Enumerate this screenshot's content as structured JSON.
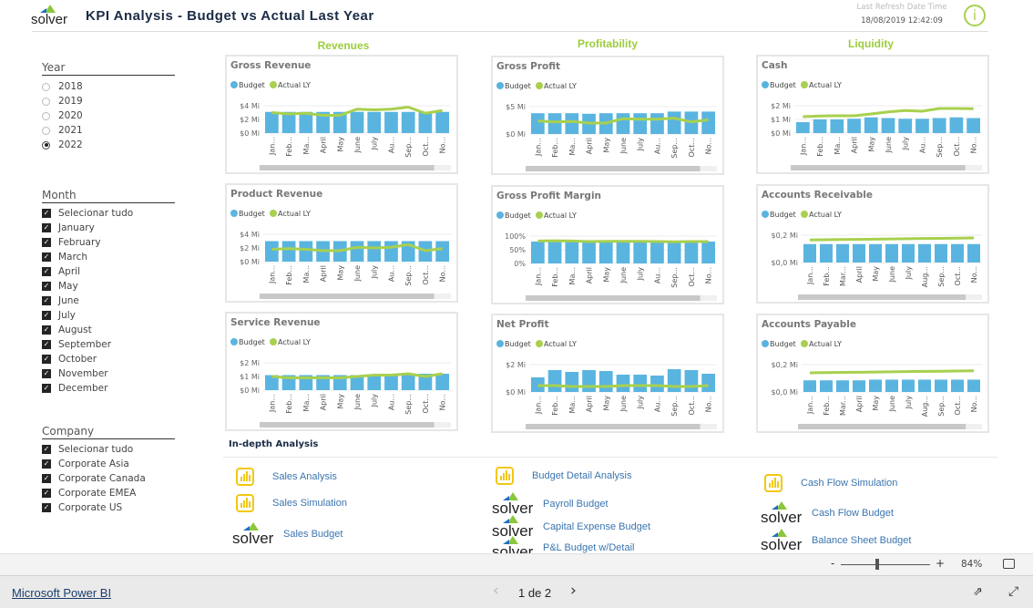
{
  "header": {
    "logo": "solver",
    "title": "KPI Analysis - Budget vs Actual Last Year",
    "refresh_label": "Last Refresh Date Time",
    "refresh_value": "18/08/2019 12:42:09",
    "info_icon": "i"
  },
  "sections": {
    "revenues": "Revenues",
    "profitability": "Profitability",
    "liquidity": "Liquidity"
  },
  "year": {
    "title": "Year",
    "options": [
      "2018",
      "2019",
      "2020",
      "2021",
      "2022"
    ],
    "selected": "2022"
  },
  "month": {
    "title": "Month",
    "options": [
      "Selecionar tudo",
      "January",
      "February",
      "March",
      "April",
      "May",
      "June",
      "July",
      "August",
      "September",
      "October",
      "November",
      "December"
    ]
  },
  "company": {
    "title": "Company",
    "options": [
      "Selecionar tudo",
      "Corporate Asia",
      "Corporate Canada",
      "Corporate EMEA",
      "Corporate US"
    ]
  },
  "colors": {
    "budget": "#5ab4e0",
    "actual": "#a8d04e",
    "section": "#9ccc3c"
  },
  "chart_data": [
    {
      "type": "bar+line",
      "title": "Gross Revenue",
      "legend": [
        "Budget",
        "Actual LY"
      ],
      "categories": [
        "Jan...",
        "Feb...",
        "Ma...",
        "April",
        "May",
        "June",
        "July",
        "Au...",
        "Sep...",
        "Oct...",
        "No..."
      ],
      "yticks": [
        "$0 Mi",
        "$2 Mi",
        "$4 Mi"
      ],
      "ylim": [
        0,
        4
      ],
      "series": [
        {
          "name": "Budget",
          "values": [
            3.1,
            3.1,
            3.1,
            3.1,
            3.1,
            3.1,
            3.1,
            3.1,
            3.1,
            3.1,
            3.1
          ]
        },
        {
          "name": "Actual LY",
          "values": [
            3.0,
            2.8,
            2.9,
            2.6,
            2.6,
            3.5,
            3.4,
            3.5,
            3.8,
            2.9,
            3.3
          ]
        }
      ]
    },
    {
      "type": "bar+line",
      "title": "Product Revenue",
      "legend": [
        "Budget",
        "Actual LY"
      ],
      "categories": [
        "Jan...",
        "Feb...",
        "Ma...",
        "April",
        "May",
        "June",
        "July",
        "Au...",
        "Sep...",
        "Oct...",
        "No..."
      ],
      "yticks": [
        "$0 Mi",
        "$2 Mi",
        "$4 Mi"
      ],
      "ylim": [
        0,
        4
      ],
      "series": [
        {
          "name": "Budget",
          "values": [
            3.0,
            3.0,
            3.0,
            3.0,
            3.0,
            3.0,
            3.0,
            3.0,
            3.0,
            3.0,
            3.0
          ]
        },
        {
          "name": "Actual LY",
          "values": [
            1.8,
            1.9,
            1.8,
            1.6,
            1.6,
            2.1,
            2.0,
            2.1,
            2.5,
            1.6,
            1.9
          ]
        }
      ]
    },
    {
      "type": "bar+line",
      "title": "Service Revenue",
      "legend": [
        "Budget",
        "Actual LY"
      ],
      "categories": [
        "Jan...",
        "Feb...",
        "Ma...",
        "April",
        "May",
        "June",
        "July",
        "Au...",
        "Sep...",
        "Oct...",
        "No..."
      ],
      "yticks": [
        "$0 Mi",
        "$1 Mi",
        "$2 Mi"
      ],
      "ylim": [
        0,
        2
      ],
      "series": [
        {
          "name": "Budget",
          "values": [
            1.1,
            1.1,
            1.1,
            1.1,
            1.1,
            1.1,
            1.1,
            1.1,
            1.2,
            1.2,
            1.2
          ]
        },
        {
          "name": "Actual LY",
          "values": [
            1.0,
            0.9,
            0.9,
            0.9,
            0.9,
            1.0,
            1.1,
            1.1,
            1.2,
            1.0,
            1.2
          ]
        }
      ]
    },
    {
      "type": "bar+line",
      "title": "Gross Profit",
      "legend": [
        "Budget",
        "Actual LY"
      ],
      "categories": [
        "Jan...",
        "Feb...",
        "Ma...",
        "April",
        "May",
        "June",
        "July",
        "Au...",
        "Sep...",
        "Oct...",
        "No..."
      ],
      "yticks": [
        "$0 Mi",
        "$5 Mi"
      ],
      "ylim": [
        0,
        5
      ],
      "series": [
        {
          "name": "Budget",
          "values": [
            3.8,
            3.8,
            3.8,
            3.7,
            3.8,
            3.8,
            3.8,
            3.8,
            4.1,
            4.1,
            4.1
          ]
        },
        {
          "name": "Actual LY",
          "values": [
            2.4,
            2.2,
            2.3,
            2.0,
            2.0,
            2.8,
            2.7,
            2.7,
            2.9,
            2.2,
            2.6
          ]
        }
      ]
    },
    {
      "type": "bar+line",
      "title": "Gross Profit Margin",
      "legend": [
        "Budget",
        "Actual LY"
      ],
      "categories": [
        "Jan...",
        "Feb...",
        "Ma...",
        "April",
        "May",
        "June",
        "July",
        "Au...",
        "Sep...",
        "Oct...",
        "No..."
      ],
      "yticks": [
        "0%",
        "50%",
        "100%"
      ],
      "ylim": [
        0,
        100
      ],
      "series": [
        {
          "name": "Budget",
          "values": [
            80,
            80,
            80,
            80,
            80,
            80,
            80,
            80,
            80,
            80,
            80
          ]
        },
        {
          "name": "Actual LY",
          "values": [
            82,
            83,
            82,
            80,
            81,
            81,
            81,
            80,
            79,
            80,
            80
          ]
        }
      ]
    },
    {
      "type": "bar+line",
      "title": "Net Profit",
      "legend": [
        "Budget",
        "Actual LY"
      ],
      "categories": [
        "Jan...",
        "Feb...",
        "Ma...",
        "April",
        "May",
        "June",
        "July",
        "Au...",
        "Sep...",
        "Oct...",
        "No..."
      ],
      "yticks": [
        "$0 Mi",
        "$2 Mi"
      ],
      "ylim": [
        0,
        3
      ],
      "series": [
        {
          "name": "Budget",
          "values": [
            1.6,
            2.4,
            2.2,
            2.4,
            2.3,
            1.9,
            1.9,
            1.8,
            2.5,
            2.4,
            2.0
          ]
        },
        {
          "name": "Actual LY",
          "values": [
            0.7,
            0.7,
            0.6,
            0.6,
            0.6,
            0.7,
            0.7,
            0.7,
            0.6,
            0.6,
            0.7
          ]
        }
      ]
    },
    {
      "type": "bar+line",
      "title": "Cash",
      "legend": [
        "Budget",
        "Actual LY"
      ],
      "categories": [
        "Jan...",
        "Feb...",
        "Ma...",
        "April",
        "May",
        "June",
        "July",
        "Au...",
        "Sep...",
        "Oct...",
        "No..."
      ],
      "yticks": [
        "$0 Mi",
        "$1 Mi",
        "$2 Mi"
      ],
      "ylim": [
        0,
        2
      ],
      "series": [
        {
          "name": "Budget",
          "values": [
            0.8,
            1.0,
            1.0,
            1.05,
            1.15,
            1.1,
            1.05,
            1.05,
            1.1,
            1.15,
            1.1
          ]
        },
        {
          "name": "Actual LY",
          "values": [
            1.2,
            1.25,
            1.27,
            1.27,
            1.4,
            1.55,
            1.65,
            1.6,
            1.8,
            1.8,
            1.78
          ]
        }
      ]
    },
    {
      "type": "bar+line",
      "title": "Accounts Receivable",
      "legend": [
        "Budget",
        "Actual LY"
      ],
      "categories": [
        "Jan...",
        "Feb...",
        "Mar...",
        "April",
        "May",
        "June",
        "July",
        "Aug...",
        "Sep...",
        "Oct...",
        "No..."
      ],
      "yticks": [
        "$0,0 Mi",
        "$0,2 Mi"
      ],
      "ylim": [
        0,
        0.4
      ],
      "series": [
        {
          "name": "Budget",
          "values": [
            0.27,
            0.27,
            0.27,
            0.27,
            0.27,
            0.27,
            0.27,
            0.27,
            0.27,
            0.27,
            0.27
          ]
        },
        {
          "name": "Actual LY",
          "values": [
            0.33,
            0.333,
            0.336,
            0.339,
            0.342,
            0.345,
            0.348,
            0.351,
            0.354,
            0.357,
            0.36
          ]
        }
      ]
    },
    {
      "type": "bar+line",
      "title": "Accounts Payable",
      "legend": [
        "Budget",
        "Actual LY"
      ],
      "categories": [
        "Jan...",
        "Feb...",
        "Mar...",
        "April",
        "May",
        "June",
        "July",
        "Aug...",
        "Sep...",
        "Oct...",
        "No..."
      ],
      "yticks": [
        "$0,0 Mi",
        "$0,2 Mi"
      ],
      "ylim": [
        0,
        0.4
      ],
      "series": [
        {
          "name": "Budget",
          "values": [
            0.17,
            0.17,
            0.17,
            0.17,
            0.18,
            0.18,
            0.18,
            0.18,
            0.18,
            0.18,
            0.18
          ]
        },
        {
          "name": "Actual LY",
          "values": [
            0.28,
            0.283,
            0.286,
            0.289,
            0.292,
            0.295,
            0.298,
            0.301,
            0.304,
            0.307,
            0.31
          ]
        }
      ]
    }
  ],
  "indepth": {
    "title": "In-depth Analysis",
    "columns": [
      [
        {
          "icon": "powerbi-icon",
          "label": "Sales  Analysis"
        },
        {
          "icon": "powerbi-icon",
          "label": "Sales Simulation"
        },
        {
          "icon": "solver-logo",
          "label": "Sales Budget",
          "logo_text": "solver"
        }
      ],
      [
        {
          "icon": "powerbi-icon",
          "label": "Budget Detail Analysis"
        },
        {
          "icon": "solver-logo",
          "label": "Payroll Budget",
          "logo_text": "solver"
        },
        {
          "icon": "solver-logo",
          "label": "Capital Expense Budget",
          "logo_text": "solver"
        },
        {
          "icon": "solver-logo",
          "label": "P&L Budget w/Detail",
          "logo_text": "solver"
        }
      ],
      [
        {
          "icon": "powerbi-icon",
          "label": "Cash Flow Simulation"
        },
        {
          "icon": "solver-logo",
          "label": "Cash Flow Budget",
          "logo_text": "solver"
        },
        {
          "icon": "solver-logo",
          "label": "Balance Sheet Budget",
          "logo_text": "solver"
        }
      ]
    ]
  },
  "footer": {
    "zoom_minus": "-",
    "zoom_plus": "+",
    "zoom_value": "84%",
    "zoom_level": 84,
    "brand_link": "Microsoft Power BI",
    "page": "1 de 2",
    "prev": "‹",
    "next": "›"
  }
}
